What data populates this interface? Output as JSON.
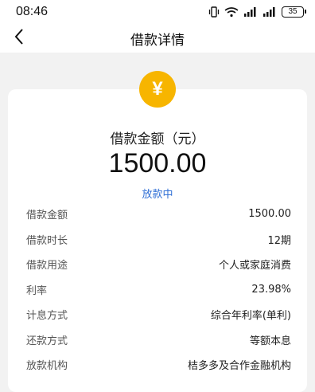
{
  "status_bar": {
    "time": "08:46",
    "battery": "35"
  },
  "header": {
    "title": "借款详情",
    "back_icon": "chevron-left-icon"
  },
  "summary": {
    "currency_symbol": "¥",
    "amount_label": "借款金额（元）",
    "amount": "1500.00",
    "status": "放款中",
    "status_color": "#2f6fd6",
    "badge_color": "#f7b500"
  },
  "details": [
    {
      "label": "借款金额",
      "value": "1500.00"
    },
    {
      "label": "借款时长",
      "value": "12期"
    },
    {
      "label": "借款用途",
      "value": "个人或家庭消费"
    },
    {
      "label": "利率",
      "value": "23.98%"
    },
    {
      "label": "计息方式",
      "value": "综合年利率(单利)"
    },
    {
      "label": "还款方式",
      "value": "等额本息"
    },
    {
      "label": "放款机构",
      "value": "桔多多及合作金融机构"
    }
  ]
}
